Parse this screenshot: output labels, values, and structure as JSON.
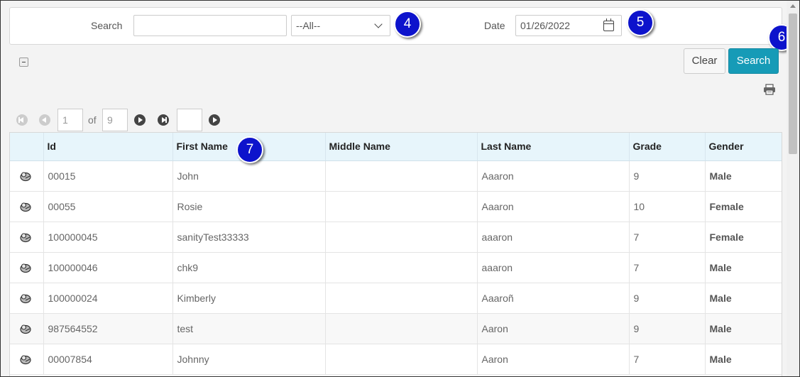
{
  "search_panel": {
    "search_label": "Search",
    "search_value": "",
    "filter_value": "--All--",
    "date_label": "Date",
    "date_value": "01/26/2022"
  },
  "callouts": {
    "filter": "4",
    "date": "5",
    "search": "6",
    "first_name": "7"
  },
  "actions": {
    "clear_label": "Clear",
    "search_label": "Search"
  },
  "icons": {
    "collapse": "collapse-icon",
    "calendar": "calendar-icon",
    "print": "printer-icon",
    "row": "student-icon",
    "dropdown": "chevron-down-icon"
  },
  "pager": {
    "page": "1",
    "of_label": "of",
    "total": "9",
    "goto_value": ""
  },
  "table": {
    "columns": [
      "Id",
      "First Name",
      "Middle Name",
      "Last Name",
      "Grade",
      "Gender"
    ],
    "rows": [
      {
        "id": "00015",
        "first": "John",
        "middle": "",
        "last": "Aaaron",
        "grade": "9",
        "gender": "Male"
      },
      {
        "id": "00055",
        "first": "Rosie",
        "middle": "",
        "last": "Aaaron",
        "grade": "10",
        "gender": "Female"
      },
      {
        "id": "100000045",
        "first": "sanityTest33333",
        "middle": "",
        "last": "aaaron",
        "grade": "7",
        "gender": "Female"
      },
      {
        "id": "100000046",
        "first": "chk9",
        "middle": "",
        "last": "aaaron",
        "grade": "7",
        "gender": "Male"
      },
      {
        "id": "100000024",
        "first": "Kimberly",
        "middle": "",
        "last": "Aaaroñ",
        "grade": "9",
        "gender": "Male"
      },
      {
        "id": "987564552",
        "first": "test",
        "middle": "",
        "last": "Aaron",
        "grade": "9",
        "gender": "Male"
      },
      {
        "id": "00007854",
        "first": "Johnny",
        "middle": "",
        "last": "Aaron",
        "grade": "7",
        "gender": "Male"
      }
    ]
  },
  "colors": {
    "accent": "#169bb7",
    "callout": "#0d13cc",
    "header_bg": "#e7f5fb"
  }
}
